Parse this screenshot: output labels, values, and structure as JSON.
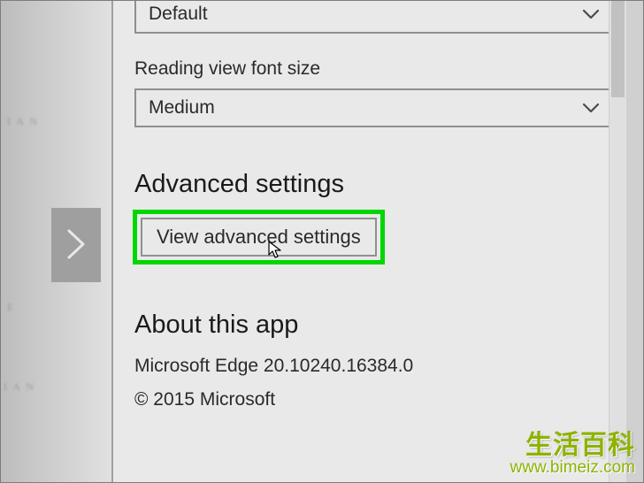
{
  "dropdown1": {
    "value": "Default"
  },
  "fontSize": {
    "label": "Reading view font size",
    "value": "Medium"
  },
  "advanced": {
    "heading": "Advanced settings",
    "button": "View advanced settings"
  },
  "about": {
    "heading": "About this app",
    "version": "Microsoft Edge 20.10240.16384.0",
    "copyright": "© 2015 Microsoft"
  },
  "watermark": {
    "main": "生活百科",
    "url": "www.bimeiz.com"
  }
}
